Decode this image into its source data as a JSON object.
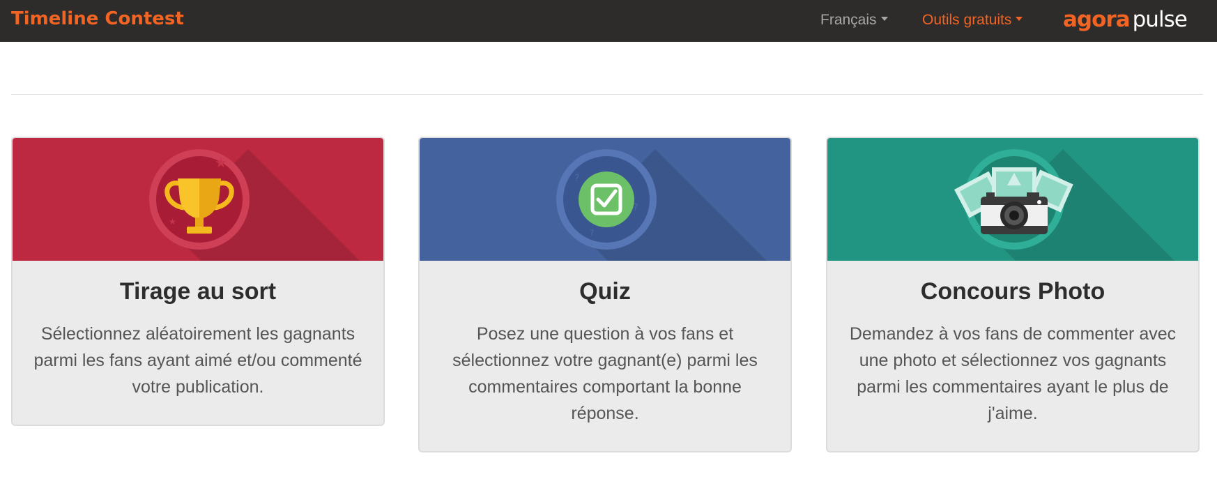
{
  "navbar": {
    "brand": "Timeline Contest",
    "language_label": "Français",
    "tools_label": "Outils gratuits",
    "logo": {
      "agora": "agora",
      "pulse": "pulse"
    },
    "colors": {
      "background": "#2d2c2a",
      "accent": "#f26423"
    }
  },
  "cards": [
    {
      "title": "Tirage au sort",
      "description": "Sélectionnez aléatoirement les gagnants parmi les fans ayant aimé et/ou commenté votre publication.",
      "icon": "trophy-icon",
      "color": "#be2942"
    },
    {
      "title": "Quiz",
      "description": "Posez une question à vos fans et sélectionnez votre gagnant(e) parmi les commentaires comportant la bonne réponse.",
      "icon": "checkbox-icon",
      "color": "#44629e"
    },
    {
      "title": "Concours Photo",
      "description": "Demandez à vos fans de commenter avec une photo et sélectionnez vos gagnants parmi les commentaires ayant le plus de j'aime.",
      "icon": "camera-icon",
      "color": "#229582"
    }
  ]
}
